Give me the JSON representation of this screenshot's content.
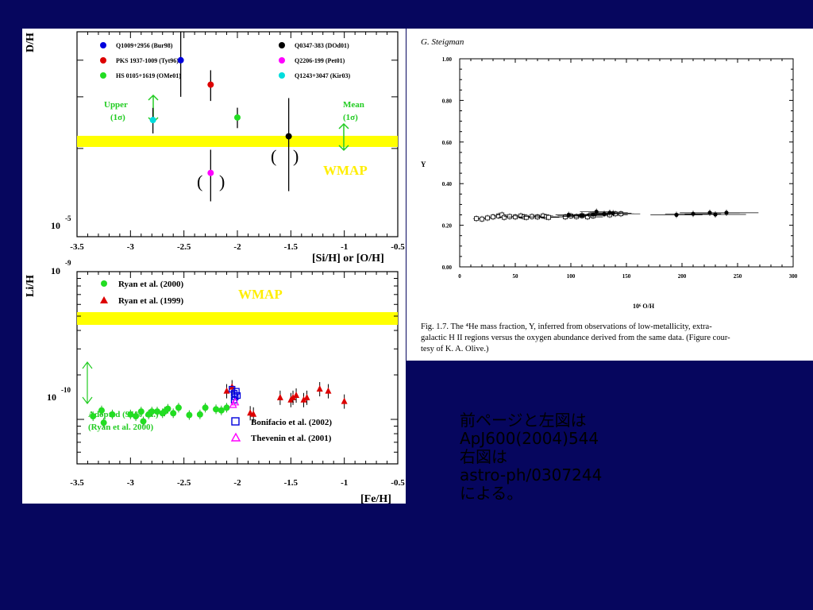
{
  "chart_data": [
    {
      "type": "scatter",
      "ylabel": "D/H",
      "xlabel": "[Si/H] or [O/H]",
      "xlim": [
        -3.5,
        -0.5
      ],
      "x_ticks": [
        "-3.5",
        "-3",
        "-2.5",
        "-2",
        "-1.5",
        "-1",
        "-0.5"
      ],
      "y_tick_label": "10",
      "y_tick_exp": "-5",
      "log_y": true,
      "band_label": "WMAP",
      "band_color": "#ffff00",
      "annotations": {
        "upper": "Upper",
        "upper_sub": "(1σ)",
        "mean": "Mean",
        "mean_sub": "(1σ)"
      },
      "series": [
        {
          "name": "Q1009+2956 (Bur98)",
          "color": "#0000dd",
          "x": [
            -2.53
          ],
          "y": [
            4e-05
          ]
        },
        {
          "name": "PKS 1937-1009 (Tyt96)",
          "color": "#dd0000",
          "x": [
            -2.25
          ],
          "y": [
            3.3e-05
          ]
        },
        {
          "name": "HS 0105+1619 (OMe01)",
          "color": "#22dd22",
          "x": [
            -2.0
          ],
          "y": [
            2.55e-05
          ]
        },
        {
          "name": "Q0347-383 (DOd01)",
          "color": "#000000",
          "x": [
            -1.52
          ],
          "y": [
            2.2e-05
          ]
        },
        {
          "name": "Q2206-199 (Pet01)",
          "color": "#ff00ff",
          "x": [
            -2.25
          ],
          "y": [
            1.65e-05
          ]
        },
        {
          "name": "Q1243+3047 (Kir03)",
          "color": "#00dddd",
          "x": [
            -2.79
          ],
          "y": [
            2.5e-05
          ]
        }
      ]
    },
    {
      "type": "scatter",
      "ylabel": "Li/H",
      "xlabel": "[Fe/H]",
      "xlim": [
        -3.5,
        -0.5
      ],
      "x_ticks": [
        "-3.5",
        "-3",
        "-2.5",
        "-2",
        "-1.5",
        "-1",
        "-0.5"
      ],
      "y_tick_labels": [
        {
          "base": "10",
          "exp": "-9"
        },
        {
          "base": "10",
          "exp": "-10"
        }
      ],
      "log_y": true,
      "band_label": "WMAP",
      "band_color": "#ffff00",
      "annotations": {
        "adopted": "Adopted (95% c.l.)",
        "adopted_sub": "(Ryan et al. 2000)"
      },
      "series": [
        {
          "name": "Ryan et al. (2000)",
          "color": "#22dd22",
          "x": [
            -3.35,
            -3.27,
            -3.25,
            -3.17,
            -3.0,
            -2.95,
            -2.9,
            -2.88,
            -2.83,
            -2.8,
            -2.75,
            -2.7,
            -2.68,
            -2.65,
            -2.6,
            -2.55,
            -2.45,
            -2.35,
            -2.3,
            -2.2,
            -2.15,
            -2.1
          ],
          "y": [
            1.05e-10,
            1.15e-10,
            9.5e-11,
            1.08e-10,
            1.08e-10,
            1.05e-10,
            1.13e-10,
            9.7e-11,
            1.08e-10,
            1.13e-10,
            1.13e-10,
            1.1e-10,
            1.13e-10,
            1.18e-10,
            1.1e-10,
            1.2e-10,
            1.07e-10,
            1.08e-10,
            1.2e-10,
            1.17e-10,
            1.15e-10,
            1.2e-10
          ]
        },
        {
          "name": "Ryan et al. (1999)",
          "color": "#dd0000",
          "x": [
            -2.1,
            -2.05,
            -1.88,
            -1.85,
            -1.6,
            -1.5,
            -1.48,
            -1.45,
            -1.38,
            -1.35,
            -1.23,
            -1.15,
            -1.0
          ],
          "y": [
            1.55e-10,
            1.65e-10,
            1.1e-10,
            1.08e-10,
            1.4e-10,
            1.35e-10,
            1.4e-10,
            1.45e-10,
            1.35e-10,
            1.4e-10,
            1.6e-10,
            1.55e-10,
            1.32e-10
          ]
        },
        {
          "name": "Bonifacio et al. (2002)",
          "color": "#0000dd",
          "x": [
            -2.05,
            -2.03,
            -2.02,
            -2.0,
            -2.03,
            -2.01
          ],
          "y": [
            1.6e-10,
            1.5e-10,
            1.42e-10,
            1.45e-10,
            1.35e-10,
            1.55e-10
          ]
        },
        {
          "name": "Thevenin et al. (2001)",
          "color": "#ff00ff",
          "x": [
            -2.04,
            -2.02
          ],
          "y": [
            1.25e-10,
            1.3e-10
          ]
        }
      ]
    },
    {
      "type": "scatter",
      "author": "G. Steigman",
      "ylabel": "Y",
      "xlabel": "10⁶ O/H",
      "xlim": [
        0,
        300
      ],
      "ylim": [
        0,
        1.0
      ],
      "x_ticks": [
        "0",
        "50",
        "100",
        "150",
        "200",
        "250",
        "300"
      ],
      "y_ticks": [
        "0.00",
        "0.20",
        "0.40",
        "0.60",
        "0.80",
        "1.00"
      ],
      "caption_line1": "Fig. 1.7. The ⁴He mass fraction, Y, inferred from observations of low-metallicity, extra-",
      "caption_line2": "galactic H II regions versus the oxygen abundance derived from the same data. (Figure cour-",
      "caption_line3": "tesy of K. A. Olive.)",
      "series": [
        {
          "name": "open",
          "x": [
            15,
            20,
            25,
            30,
            35,
            38,
            40,
            45,
            50,
            55,
            58,
            60,
            65,
            70,
            75,
            78,
            80,
            95,
            100,
            105,
            110,
            115,
            118,
            120,
            135,
            140,
            145
          ],
          "y": [
            0.232,
            0.23,
            0.235,
            0.24,
            0.245,
            0.25,
            0.238,
            0.242,
            0.24,
            0.245,
            0.24,
            0.238,
            0.242,
            0.24,
            0.245,
            0.24,
            0.238,
            0.24,
            0.245,
            0.242,
            0.246,
            0.24,
            0.25,
            0.245,
            0.25,
            0.255,
            0.255
          ]
        },
        {
          "name": "filled",
          "x": [
            98,
            110,
            120,
            123,
            130,
            135,
            138,
            195,
            210,
            225,
            230,
            240
          ],
          "y": [
            0.25,
            0.248,
            0.252,
            0.265,
            0.255,
            0.26,
            0.258,
            0.25,
            0.255,
            0.26,
            0.252,
            0.26
          ]
        }
      ]
    }
  ],
  "note": {
    "line1": "前ページと左図は",
    "line2": "ApJ600(2004)544",
    "line3": "右図は",
    "line4": "astro-ph/0307244",
    "line5": "による。"
  }
}
